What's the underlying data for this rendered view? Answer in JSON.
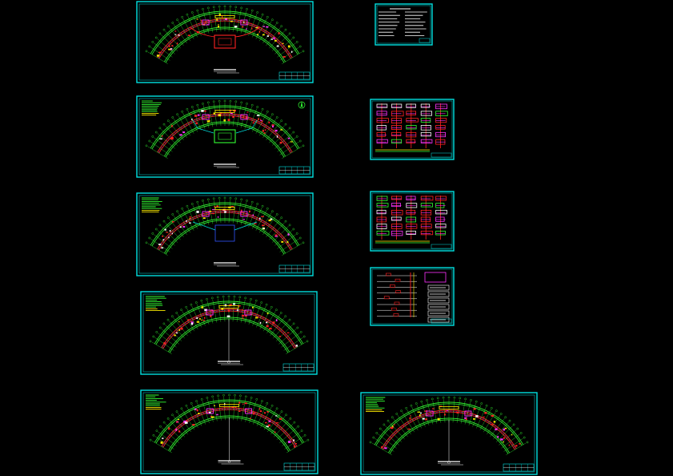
{
  "drawing_set": {
    "background": "#000000",
    "colors": {
      "frame": "#00e0e0",
      "wall": "#33ff33",
      "wall_alt": "#00ff66",
      "pipe_red": "#ff2222",
      "pipe_magenta": "#ff33ff",
      "pipe_yellow": "#ffee00",
      "grid_axis": "#33ff33",
      "note_text": "#ffffff",
      "blue_line": "#3355ff"
    },
    "sheets": [
      {
        "id": "floor-plan-1",
        "kind": "arc-floor-plan",
        "has_notes": false,
        "has_compass": false
      },
      {
        "id": "floor-plan-2",
        "kind": "arc-floor-plan",
        "has_notes": true,
        "has_compass": true
      },
      {
        "id": "floor-plan-3",
        "kind": "arc-floor-plan",
        "has_notes": true,
        "has_compass": false
      },
      {
        "id": "floor-plan-4",
        "kind": "arc-floor-plan",
        "has_notes": true,
        "has_compass": false
      },
      {
        "id": "floor-plan-5",
        "kind": "arc-floor-plan",
        "has_notes": true,
        "has_compass": false
      },
      {
        "id": "floor-plan-6",
        "kind": "arc-floor-plan",
        "has_notes": true,
        "has_compass": false
      },
      {
        "id": "design-notes",
        "kind": "text-sheet"
      },
      {
        "id": "system-diagram-1",
        "kind": "riser-diagram"
      },
      {
        "id": "system-diagram-2",
        "kind": "riser-diagram"
      },
      {
        "id": "system-diagram-3",
        "kind": "riser-diagram"
      }
    ]
  }
}
